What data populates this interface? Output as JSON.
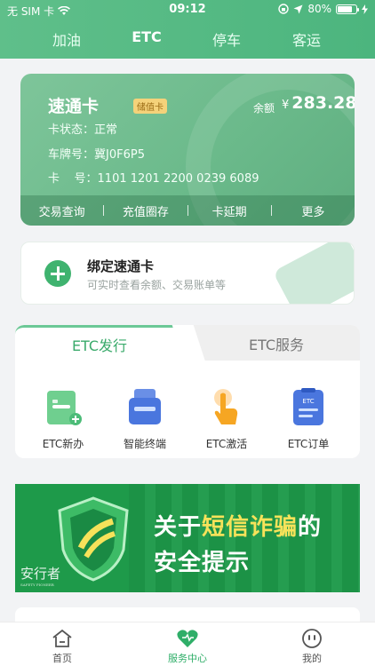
{
  "status_bar": {
    "carrier": "无 SIM 卡",
    "time": "09:12",
    "battery": "80%",
    "battery_level": 0.8
  },
  "top_tabs": [
    {
      "label": "加油"
    },
    {
      "label": "ETC"
    },
    {
      "label": "停车"
    },
    {
      "label": "客运"
    }
  ],
  "active_top_tab": "ETC",
  "card": {
    "title": "速通卡",
    "badge": "储值卡",
    "balance_label": "余额",
    "currency": "¥",
    "balance": "283.28",
    "status": "卡状态：正常",
    "plate": "车牌号：冀J0F6P5",
    "number_label": "卡    号：",
    "number": "1101 1201 2200 0239 6089",
    "actions": [
      "交易查询",
      "充值圈存",
      "卡延期",
      "更多"
    ]
  },
  "bind": {
    "title": "绑定速通卡",
    "subtitle": "可实时查看余额、交易账单等"
  },
  "service_tabs": [
    "ETC发行",
    "ETC服务"
  ],
  "services": [
    {
      "label": "ETC新办",
      "icon": "etc-new-icon"
    },
    {
      "label": "智能终端",
      "icon": "smart-terminal-icon"
    },
    {
      "label": "ETC激活",
      "icon": "etc-activate-icon"
    },
    {
      "label": "ETC订单",
      "icon": "etc-order-icon"
    }
  ],
  "banner": {
    "line1_a": "关于",
    "line1_b": "短信诈骗",
    "line1_c": "的",
    "line2": "安全提示",
    "logo": "安行者",
    "logo_sub": "SAFETY PIONEER"
  },
  "bottom_tabs": [
    {
      "label": "首页"
    },
    {
      "label": "服务中心"
    },
    {
      "label": "我的"
    }
  ],
  "active_bottom_tab": "服务中心",
  "colors": {
    "brand_green": "#4cb57e",
    "active_green": "#2fae68",
    "banner_green": "#1e9a4a",
    "highlight_yellow": "#f6e25a"
  }
}
